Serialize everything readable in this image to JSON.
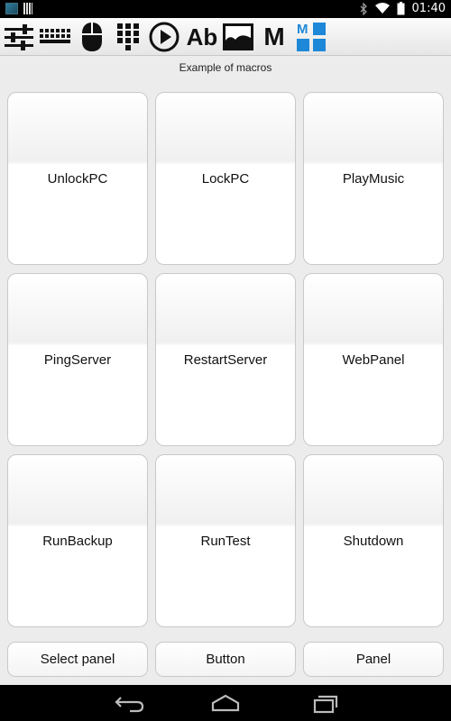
{
  "status_bar": {
    "time": "01:40",
    "icons": [
      "app-icon",
      "barcode-icon",
      "bluetooth-icon",
      "wifi-icon",
      "battery-icon"
    ]
  },
  "toolbar": {
    "items": [
      {
        "name": "sliders-icon"
      },
      {
        "name": "keyboard-icon"
      },
      {
        "name": "mouse-icon"
      },
      {
        "name": "numpad-icon"
      },
      {
        "name": "play-icon"
      },
      {
        "name": "text-icon",
        "label": "Ab"
      },
      {
        "name": "image-icon"
      },
      {
        "name": "macro-icon",
        "label": "M"
      },
      {
        "name": "macro-panel-icon",
        "label": "M"
      }
    ],
    "accent": "#1e88d8"
  },
  "panel": {
    "title": "Example of macros",
    "macros": [
      {
        "label": "UnlockPC"
      },
      {
        "label": "LockPC"
      },
      {
        "label": "PlayMusic"
      },
      {
        "label": "PingServer"
      },
      {
        "label": "RestartServer"
      },
      {
        "label": "WebPanel"
      },
      {
        "label": "RunBackup"
      },
      {
        "label": "RunTest"
      },
      {
        "label": "Shutdown"
      }
    ]
  },
  "bottom_bar": {
    "select_panel": "Select panel",
    "button": "Button",
    "panel": "Panel"
  },
  "nav_bar": {
    "icons": [
      "back-icon",
      "home-icon",
      "recent-apps-icon"
    ]
  }
}
